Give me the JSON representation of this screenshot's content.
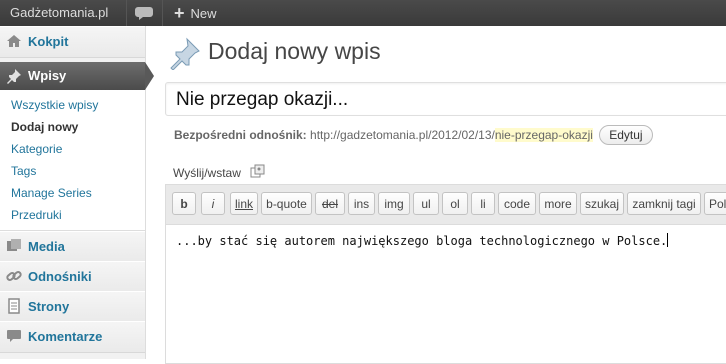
{
  "adminbar": {
    "site_name": "Gadżetomania.pl",
    "comments_icon": "speech-bubble-icon",
    "new_label": "New",
    "new_icon": "plus-icon"
  },
  "sidebar": {
    "items": [
      {
        "label": "Kokpit",
        "icon": "house-icon"
      },
      {
        "label": "Wpisy",
        "icon": "pushpin-icon",
        "active": true
      },
      {
        "label": "Media",
        "icon": "media-icon"
      },
      {
        "label": "Odnośniki",
        "icon": "chain-link-icon"
      },
      {
        "label": "Strony",
        "icon": "pages-icon"
      },
      {
        "label": "Komentarze",
        "icon": "speech-bubble-icon"
      }
    ],
    "submenu": [
      {
        "label": "Wszystkie wpisy"
      },
      {
        "label": "Dodaj nowy",
        "current": true
      },
      {
        "label": "Kategorie"
      },
      {
        "label": "Tags"
      },
      {
        "label": "Manage Series"
      },
      {
        "label": "Przedruki"
      }
    ]
  },
  "main": {
    "page_title": "Dodaj nowy wpis",
    "title_value": "Nie przegap okazji...",
    "permalink": {
      "label": "Bezpośredni odnośnik:",
      "base_url": "http://gadzetomania.pl/2012/02/13/",
      "slug": "nie-przegap-okazji",
      "edit_label": "Edytuj"
    },
    "upload_label": "Wyślij/wstaw",
    "toolbar": [
      "b",
      "i",
      "link",
      "b-quote",
      "del",
      "ins",
      "img",
      "ul",
      "ol",
      "li",
      "code",
      "more",
      "szukaj",
      "zamknij tagi",
      "Poll"
    ],
    "editor_text": "...by stać się autorem największego bloga technologicznego w Polsce."
  },
  "colors": {
    "accent": "#21759b",
    "adminbar_bg": "#464646",
    "slug_highlight": "#fffbcc"
  }
}
